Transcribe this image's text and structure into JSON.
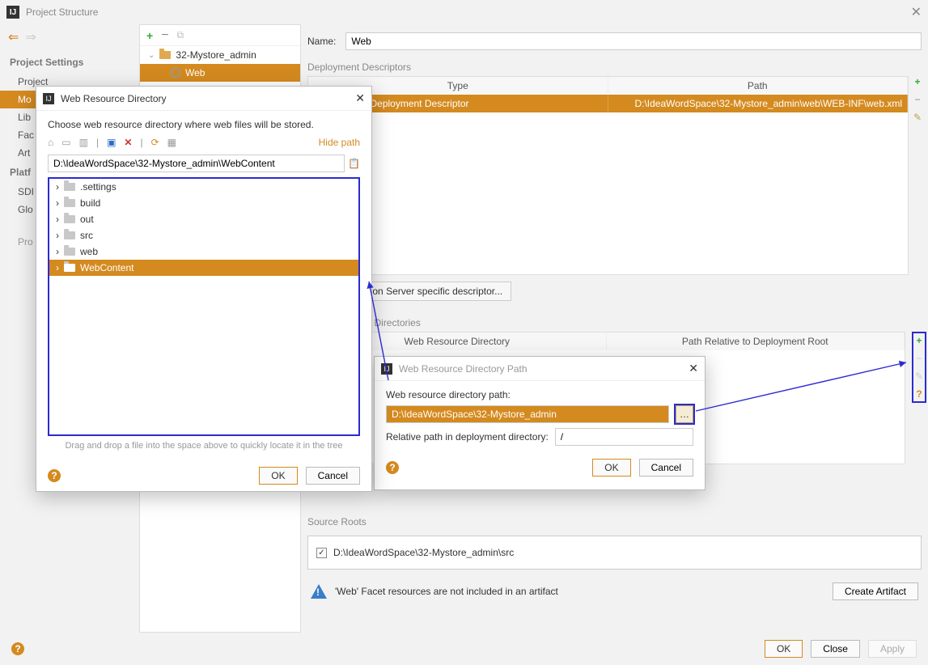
{
  "window": {
    "title": "Project Structure"
  },
  "sidebar": {
    "settings_header": "Project Settings",
    "items": [
      "Project",
      "Mo",
      "Lib",
      "Fac",
      "Art"
    ],
    "platform_header": "Platf",
    "platform_items": [
      "SDI",
      "Glo"
    ],
    "problems": "Pro"
  },
  "tree": {
    "project": "32-Mystore_admin",
    "web": "Web"
  },
  "right": {
    "name_label": "Name:",
    "name_value": "Web",
    "dep_desc_label": "Deployment Descriptors",
    "dep_table": {
      "headers": [
        "Type",
        "Path"
      ],
      "row": [
        "Web Module Deployment Descriptor",
        "D:\\IdeaWordSpace\\32-Mystore_admin\\web\\WEB-INF\\web.xml"
      ]
    },
    "server_btn": "Add Application Server specific descriptor...",
    "web_res_label": "Web Resource Directories",
    "wr_headers": [
      "Web Resource Directory",
      "Path Relative to Deployment Root"
    ],
    "source_roots_label": "Source Roots",
    "source_root": "D:\\IdeaWordSpace\\32-Mystore_admin\\src",
    "warning": "'Web' Facet resources are not included in an artifact",
    "create_artifact": "Create Artifact"
  },
  "footer": {
    "ok": "OK",
    "close": "Close",
    "apply": "Apply"
  },
  "dir_dialog": {
    "title": "Web Resource Directory",
    "desc": "Choose web resource directory where web files will be stored.",
    "hide_path": "Hide path",
    "path": "D:\\IdeaWordSpace\\32-Mystore_admin\\WebContent",
    "folders": [
      ".settings",
      "build",
      "out",
      "src",
      "web",
      "WebContent"
    ],
    "hint": "Drag and drop a file into the space above to quickly locate it in the tree",
    "ok": "OK",
    "cancel": "Cancel"
  },
  "path_dialog": {
    "title": "Web Resource Directory Path",
    "path_label": "Web resource directory path:",
    "path_value": "D:\\IdeaWordSpace\\32-Mystore_admin",
    "rel_label": "Relative path in deployment directory:",
    "rel_value": "/",
    "ok": "OK",
    "cancel": "Cancel"
  }
}
